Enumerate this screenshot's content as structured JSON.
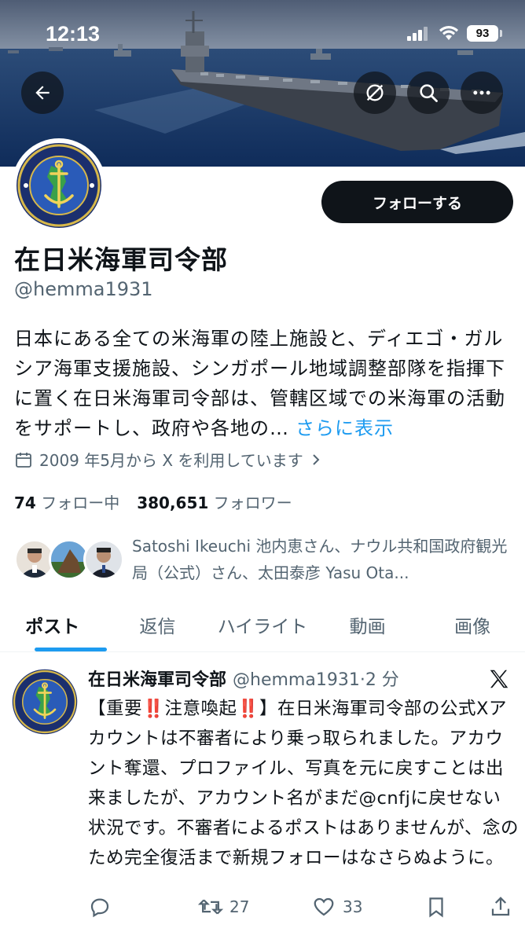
{
  "status_bar": {
    "time": "12:13",
    "battery": "93"
  },
  "banner": {
    "icons": [
      "back-arrow-icon",
      "grok-icon",
      "search-icon",
      "more-icon"
    ]
  },
  "profile": {
    "display_name": "在日米海軍司令部",
    "handle": "@hemma1931",
    "follow_button": "フォローする",
    "bio": "日本にある全ての米海軍の陸上施設と、ディエゴ・ガルシア海軍支援施設、シンガポール地域調整部隊を指揮下に置く在日米海軍司令部は、管轄区域での米海軍の活動をサポートし、政府や各地の…",
    "bio_more": "さらに表示",
    "joined": "2009 年5月から X を利用しています",
    "following_count": "74",
    "following_label": "フォロー中",
    "followers_count": "380,651",
    "followers_label": "フォロワー",
    "followers_you_know": "Satoshi Ikeuchi 池内恵さん、ナウル共和国政府観光局（公式）さん、太田泰彦 Yasu Ota..."
  },
  "tabs": [
    {
      "label": "ポスト",
      "active": true
    },
    {
      "label": "返信",
      "active": false
    },
    {
      "label": "ハイライト",
      "active": false
    },
    {
      "label": "動画",
      "active": false
    },
    {
      "label": "画像",
      "active": false
    }
  ],
  "post": {
    "author": "在日米海軍司令部",
    "handle_time": "@hemma1931·2 分",
    "text": "【重要‼️注意喚起‼️】在日米海軍司令部の公式Xアカウントは不審者により乗っ取られました。アカウント奪還、プロファイル、写真を元に戻すことは出来ましたが、アカウント名がまだ@cnfjに戻せない状況です。不審者によるポストはありませんが、念のため完全復活まで新規フォローはなさらぬように。",
    "reply_count": "",
    "retweet_count": "27",
    "like_count": "33"
  },
  "colors": {
    "accent": "#1d9bf0",
    "text": "#0f1419",
    "muted": "#536471"
  }
}
